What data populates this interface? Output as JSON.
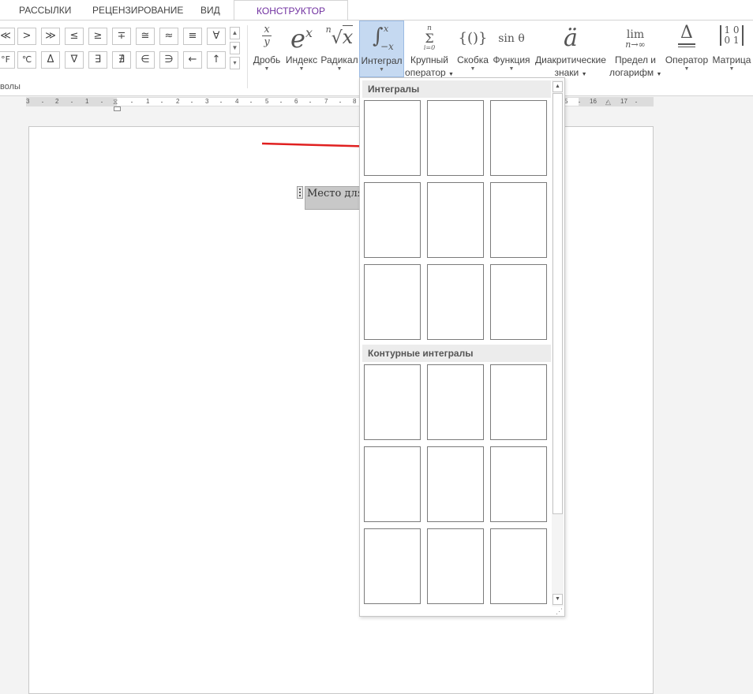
{
  "tabs": [
    "РАССЫЛКИ",
    "РЕЦЕНЗИРОВАНИЕ",
    "ВИД",
    "КОНСТРУКТОР"
  ],
  "active_tab": "КОНСТРУКТОР",
  "symbols": {
    "row1": [
      "≪",
      ">",
      "≫",
      "≤",
      "≥",
      "∓",
      "≅",
      "≈",
      "≡",
      "∀"
    ],
    "row2": [
      "°F",
      "℃",
      "Δ",
      "∇",
      "∃",
      "∄",
      "∈",
      "∋",
      "←",
      "↑"
    ],
    "group_label": "волы"
  },
  "ribbon": {
    "fraction": {
      "icon_top": "x",
      "icon_bottom": "y",
      "label": "Дробь"
    },
    "script": {
      "icon_base": "e",
      "icon_sup": "x",
      "label": "Индекс"
    },
    "radical": {
      "icon_index": "n",
      "icon_radical": "√",
      "icon_arg": "x",
      "label": "Радикал"
    },
    "integral": {
      "icon_sign": "∫",
      "icon_upper": "x",
      "icon_lower": "−x",
      "label": "Интеграл"
    },
    "large_operator": {
      "icon_upper": "n",
      "icon_sign": "Σ",
      "icon_lower": "i=0",
      "label_line1": "Крупный",
      "label_line2": "оператор"
    },
    "bracket": {
      "icon": "{()}",
      "label": "Скобка"
    },
    "function": {
      "icon": "sin θ",
      "label": "Функция"
    },
    "accent": {
      "icon": "ä",
      "label_line1": "Диакритические",
      "label_line2": "знаки"
    },
    "limit": {
      "icon_top": "lim",
      "icon_bottom": "n→∞",
      "label_line1": "Предел и",
      "label_line2": "логарифм"
    },
    "operator": {
      "icon": "Δ",
      "label": "Оператор"
    },
    "matrix": {
      "icon_row1": "1 0",
      "icon_row2": "0 1",
      "label": "Матрица"
    }
  },
  "ruler": {
    "left_numbers": [
      "3",
      "2",
      "1"
    ],
    "main_numbers": [
      "1",
      "2",
      "3",
      "4",
      "5",
      "6",
      "7",
      "8"
    ],
    "right_numbers": [
      "5",
      "16",
      "17"
    ]
  },
  "equation_placeholder": "Место для формулы.",
  "gallery": {
    "section1_title": "Интегралы",
    "section2_title": "Контурные интегралы"
  },
  "colors": {
    "accent_tab": "#7030a0",
    "arrow": "#e02020",
    "selected_button": "#c5d9f1"
  }
}
